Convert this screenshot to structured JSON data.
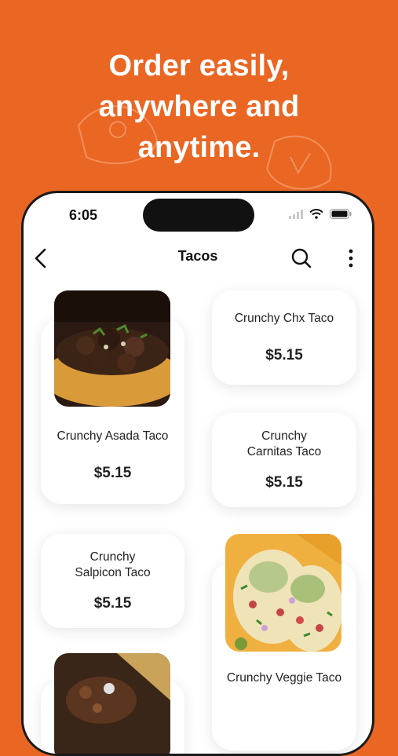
{
  "promo": {
    "line1": "Order easily,",
    "line2": "anywhere and",
    "line3": "anytime."
  },
  "status_bar": {
    "time": "6:05"
  },
  "nav": {
    "title": "Tacos"
  },
  "items": [
    {
      "name": "Crunchy Asada Taco",
      "price": "$5.15"
    },
    {
      "name": "Crunchy Chx Taco",
      "price": "$5.15"
    },
    {
      "name_line1": "Crunchy",
      "name_line2": "Carnitas Taco",
      "price": "$5.15"
    },
    {
      "name_line1": "Crunchy",
      "name_line2": "Salpicon Taco",
      "price": "$5.15"
    },
    {
      "name": "Crunchy Veggie Taco"
    }
  ],
  "colors": {
    "brand": "#ea6623",
    "card": "#ffffff",
    "text": "#222222"
  }
}
